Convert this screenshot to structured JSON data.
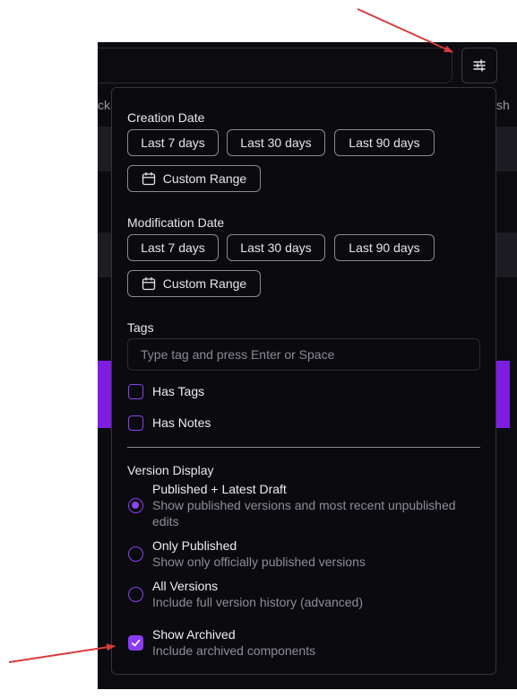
{
  "background": {
    "fragment_left": "ck",
    "fragment_right": "sh"
  },
  "filter_button": {
    "icon": "sliders-icon"
  },
  "creation_date": {
    "label": "Creation Date",
    "options": [
      "Last 7 days",
      "Last 30 days",
      "Last 90 days"
    ],
    "custom": "Custom Range"
  },
  "modification_date": {
    "label": "Modification Date",
    "options": [
      "Last 7 days",
      "Last 30 days",
      "Last 90 days"
    ],
    "custom": "Custom Range"
  },
  "tags": {
    "label": "Tags",
    "placeholder": "Type tag and press Enter or Space",
    "value": ""
  },
  "checkboxes": {
    "has_tags": {
      "label": "Has Tags",
      "checked": false
    },
    "has_notes": {
      "label": "Has Notes",
      "checked": false
    }
  },
  "version_display": {
    "label": "Version Display",
    "options": [
      {
        "title": "Published + Latest Draft",
        "desc_line1": "Show published versions and most recent unpublished",
        "desc_line2": "edits",
        "selected": true
      },
      {
        "title": "Only Published",
        "desc": "Show only officially published versions",
        "selected": false
      },
      {
        "title": "All Versions",
        "desc": "Include full version history (advanced)",
        "selected": false
      }
    ]
  },
  "show_archived": {
    "title": "Show Archived",
    "desc": "Include archived components",
    "checked": true
  },
  "colors": {
    "accent": "#8b3cf2",
    "annotation_arrow": "#d93a3a",
    "panel_bg": "#0a0a0f"
  }
}
